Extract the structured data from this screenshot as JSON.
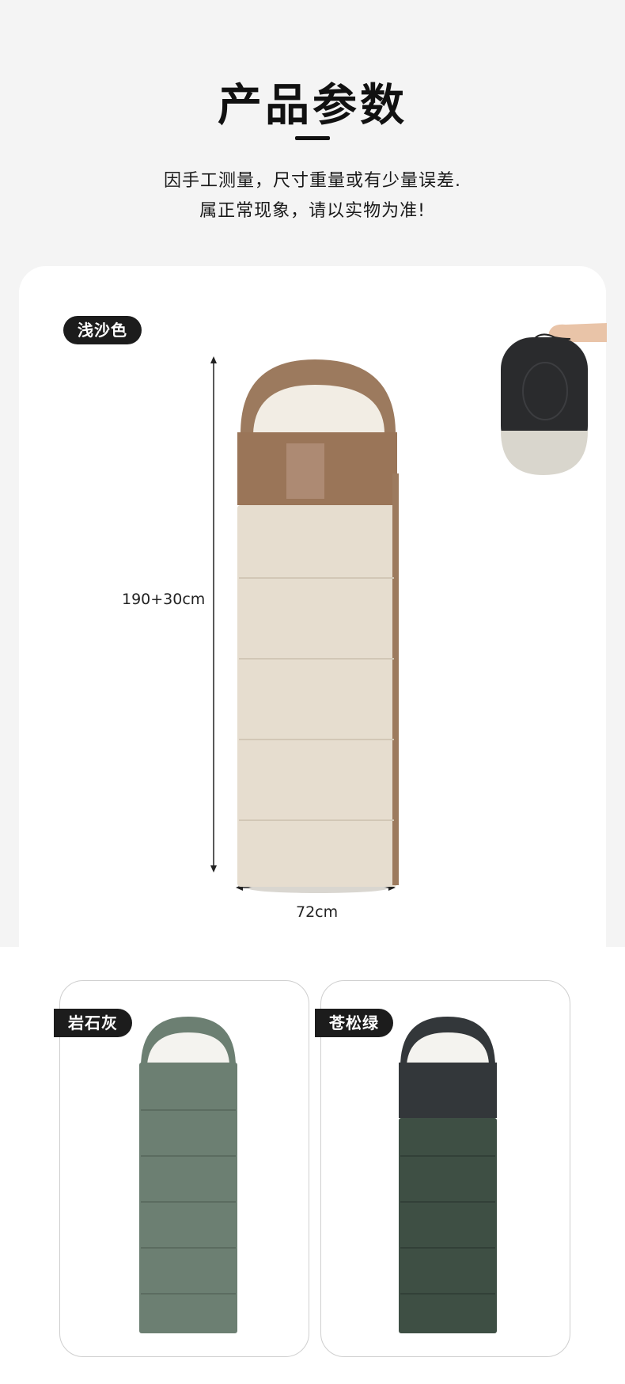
{
  "header": {
    "title": "产品参数",
    "note_line1": "因手工测量，尺寸重量或有少量误差.",
    "note_line2": "属正常现象，请以实物为准!"
  },
  "main_product": {
    "color_label": "浅沙色",
    "length_label": "190+30cm",
    "width_label": "72cm"
  },
  "variants": [
    {
      "label": "岩石灰"
    },
    {
      "label": "苍松绿"
    }
  ],
  "colors": {
    "sand_shell": "#9c7a5e",
    "sand_body": "#e6ddcf",
    "rock_grey": "#6c7f72",
    "pine_green": "#3e4f44",
    "pine_head": "#33373a",
    "pill_bg": "#1c1c1c"
  }
}
